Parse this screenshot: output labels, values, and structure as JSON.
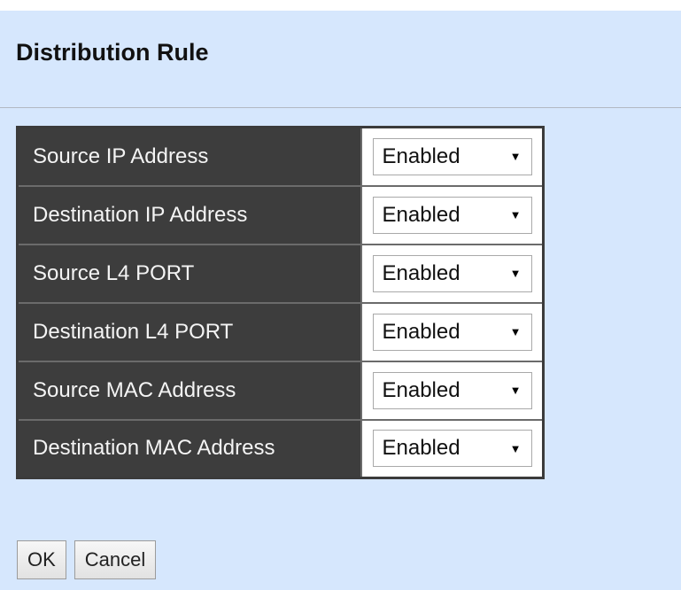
{
  "page": {
    "title": "Distribution Rule"
  },
  "rules": [
    {
      "label": "Source IP Address",
      "value": "Enabled"
    },
    {
      "label": "Destination IP Address",
      "value": "Enabled"
    },
    {
      "label": "Source L4 PORT",
      "value": "Enabled"
    },
    {
      "label": "Destination L4 PORT",
      "value": "Enabled"
    },
    {
      "label": "Source MAC Address",
      "value": "Enabled"
    },
    {
      "label": "Destination MAC Address",
      "value": "Enabled"
    }
  ],
  "buttons": {
    "ok_label": "OK",
    "cancel_label": "Cancel"
  },
  "icons": {
    "dropdown": "chevron-down-icon"
  },
  "colors": {
    "panel_background": "#d6e7fd",
    "label_cell_background": "#3d3d3d",
    "label_text": "#f4f4f4"
  }
}
